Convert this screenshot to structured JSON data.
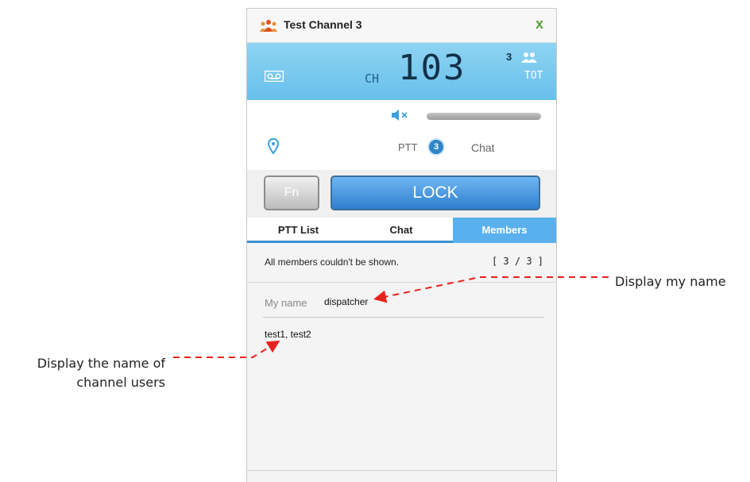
{
  "annotations": {
    "my_name": "Display my name",
    "channel_users_line1": "Display the name of",
    "channel_users_line2": "channel users"
  },
  "window": {
    "title": "Test Channel 3",
    "close_label": "x"
  },
  "lcd": {
    "ch_label": "CH",
    "channel_number": "103",
    "member_count": "3",
    "tot_label": "TOT",
    "icons": [
      "tape-icon",
      "users-icon"
    ]
  },
  "status": {
    "ptt_label": "PTT",
    "ptt_count": "3",
    "chat_label": "Chat",
    "icons": [
      "mute-icon",
      "location-pin-icon"
    ]
  },
  "controls": {
    "fn_label": "Fn",
    "lock_label": "LOCK"
  },
  "tabs": [
    {
      "label": "PTT List"
    },
    {
      "label": "Chat"
    },
    {
      "label": "Members",
      "active": true
    }
  ],
  "members": {
    "notice": "All members couldn't be shown.",
    "count": "[ 3 / 3 ]",
    "my_name_label": "My name",
    "my_name_value": "dispatcher",
    "channel_users": "test1, test2"
  },
  "colors": {
    "accent": "#5ab0ec",
    "lcd": "#6fc4ee",
    "annotation_arrow": "#e8221e"
  }
}
